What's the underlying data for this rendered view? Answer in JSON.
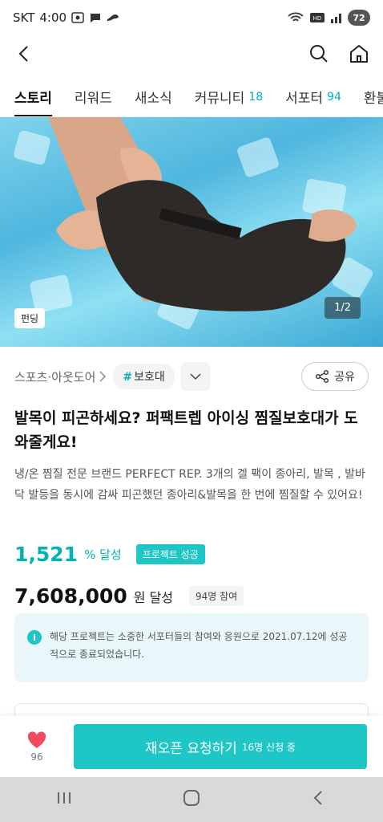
{
  "status_bar": {
    "carrier": "SKT",
    "time": "4:00",
    "battery": "72"
  },
  "nav": {
    "back_icon": "chevron-left-icon",
    "search_icon": "search-icon",
    "home_icon": "home-icon"
  },
  "tabs": [
    {
      "label": "스토리",
      "count": "",
      "active": true
    },
    {
      "label": "리워드",
      "count": ""
    },
    {
      "label": "새소식",
      "count": ""
    },
    {
      "label": "커뮤니티",
      "count": "18"
    },
    {
      "label": "서포터",
      "count": "94"
    },
    {
      "label": "환불",
      "count": ""
    }
  ],
  "hero": {
    "badge": "펀딩",
    "pager": "1/2"
  },
  "category": {
    "label": "스포츠·아웃도어",
    "tag": "보호대",
    "share_label": "공유"
  },
  "title": "발목이 피곤하세요? 퍼팩트렙 아이싱 찜질보호대가 도와줄게요!",
  "description": "냉/온 찜질 전문 브랜드 PERFECT REP. 3개의 겔 팩이 종아리, 발목 , 발바닥 발등을 동시에 감싸 피곤했던 종아리&발목을 한 번에 찜질할 수 있어요!",
  "stats": {
    "rate": "1,521",
    "rate_unit": "% 달성",
    "status_badge": "프로젝트 성공",
    "amount": "7,608,000",
    "amount_unit": "원 달성",
    "participants": "94명 참여"
  },
  "notice": {
    "text": "해당 프로젝트는 소중한 서포터들의 참여와 응원으로 2021.07.12에 성공적으로 종료되었습니다."
  },
  "bottom": {
    "like_count": "96",
    "cta_label": "재오픈 요청하기",
    "cta_sub": "16명 신청 중"
  },
  "colors": {
    "accent": "#1ec6c6",
    "accent_text": "#00b2b2"
  }
}
